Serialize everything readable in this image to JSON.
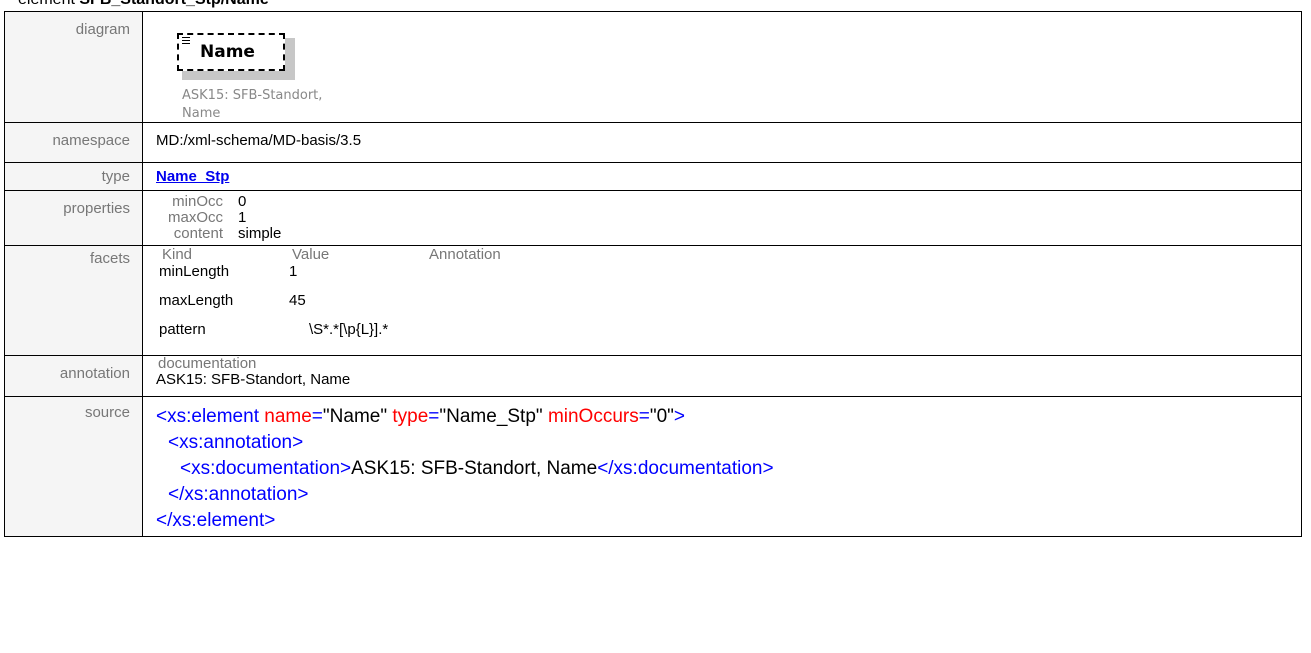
{
  "heading": {
    "prefix": "element ",
    "bold": "SFB_Standort_Stp/Name"
  },
  "rows": {
    "diagram": {
      "label": "diagram",
      "node_name": "Name",
      "node_doc": "ASK15: SFB-Standort, Name"
    },
    "namespace": {
      "label": "namespace",
      "value": "MD:/xml-schema/MD-basis/3.5"
    },
    "type": {
      "label": "type",
      "value": "Name_Stp"
    },
    "properties": {
      "label": "properties",
      "items": [
        {
          "key": "minOcc",
          "value": "0"
        },
        {
          "key": "maxOcc",
          "value": "1"
        },
        {
          "key": "content",
          "value": "simple"
        }
      ]
    },
    "facets": {
      "label": "facets",
      "headers": [
        "Kind",
        "Value",
        "Annotation"
      ],
      "rows": [
        {
          "kind": "minLength",
          "value": "1"
        },
        {
          "kind": "maxLength",
          "value": "45"
        },
        {
          "kind": "pattern",
          "value": "\\S*.*[\\p{L}].*"
        }
      ]
    },
    "annotation": {
      "label": "annotation",
      "sub": "documentation",
      "text": "ASK15: SFB-Standort, Name"
    },
    "source": {
      "label": "source",
      "l1_open": "<xs:element",
      "l1_a1": "name",
      "l1_v1": "\"Name\"",
      "l1_a2": "type",
      "l1_v2": "\"Name_Stp\"",
      "l1_a3": "minOccurs",
      "l1_v3": "\"0\"",
      "l1_close": ">",
      "l2": "<xs:annotation>",
      "l3_open": "<xs:documentation>",
      "l3_text": "ASK15: SFB-Standort, Name",
      "l3_close": "</xs:documentation>",
      "l4": "</xs:annotation>",
      "l5": "</xs:element>"
    }
  }
}
